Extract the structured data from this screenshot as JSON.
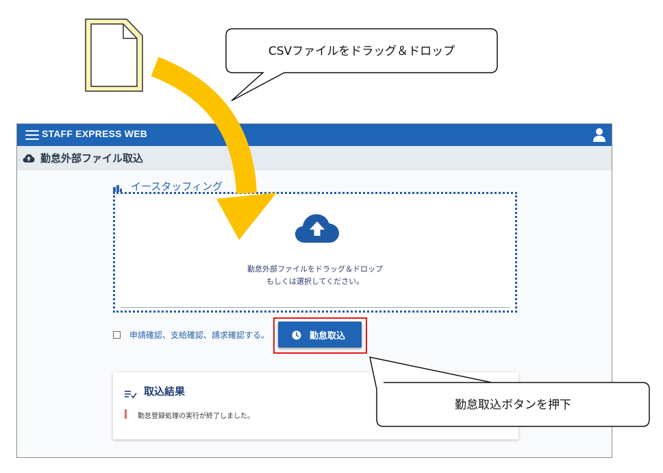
{
  "app": {
    "title": "STAFF EXPRESS WEB",
    "page_title": "勤怠外部ファイル取込"
  },
  "upload": {
    "department": "イースタッフィング",
    "drop_message_line1": "勤怠外部ファイルをドラッグ＆ドロップ",
    "drop_message_line2": "もしくは選択してください。"
  },
  "options": {
    "confirm_label": "申請確認、支給確認、請求確認する。",
    "confirm_checked": false
  },
  "actions": {
    "import_button_label": "勤怠取込"
  },
  "result": {
    "title": "取込結果",
    "message": "勤怠登録処理の実行が終了しました。"
  },
  "annotations": {
    "drag_callout": "CSVファイルをドラッグ＆ドロップ",
    "button_callout": "勤怠取込ボタンを押下"
  },
  "colors": {
    "brand_blue": "#1f65b8",
    "arrow_yellow": "#fcc200",
    "highlight_red": "#e41616",
    "file_icon_fill": "#fff4b8"
  },
  "icons": {
    "menu": "hamburger-menu-icon",
    "user": "user-icon",
    "cloud_upload": "cloud-upload-icon",
    "building": "building-icon",
    "clock": "clock-icon",
    "result": "list-check-icon",
    "file": "document-file-icon"
  }
}
